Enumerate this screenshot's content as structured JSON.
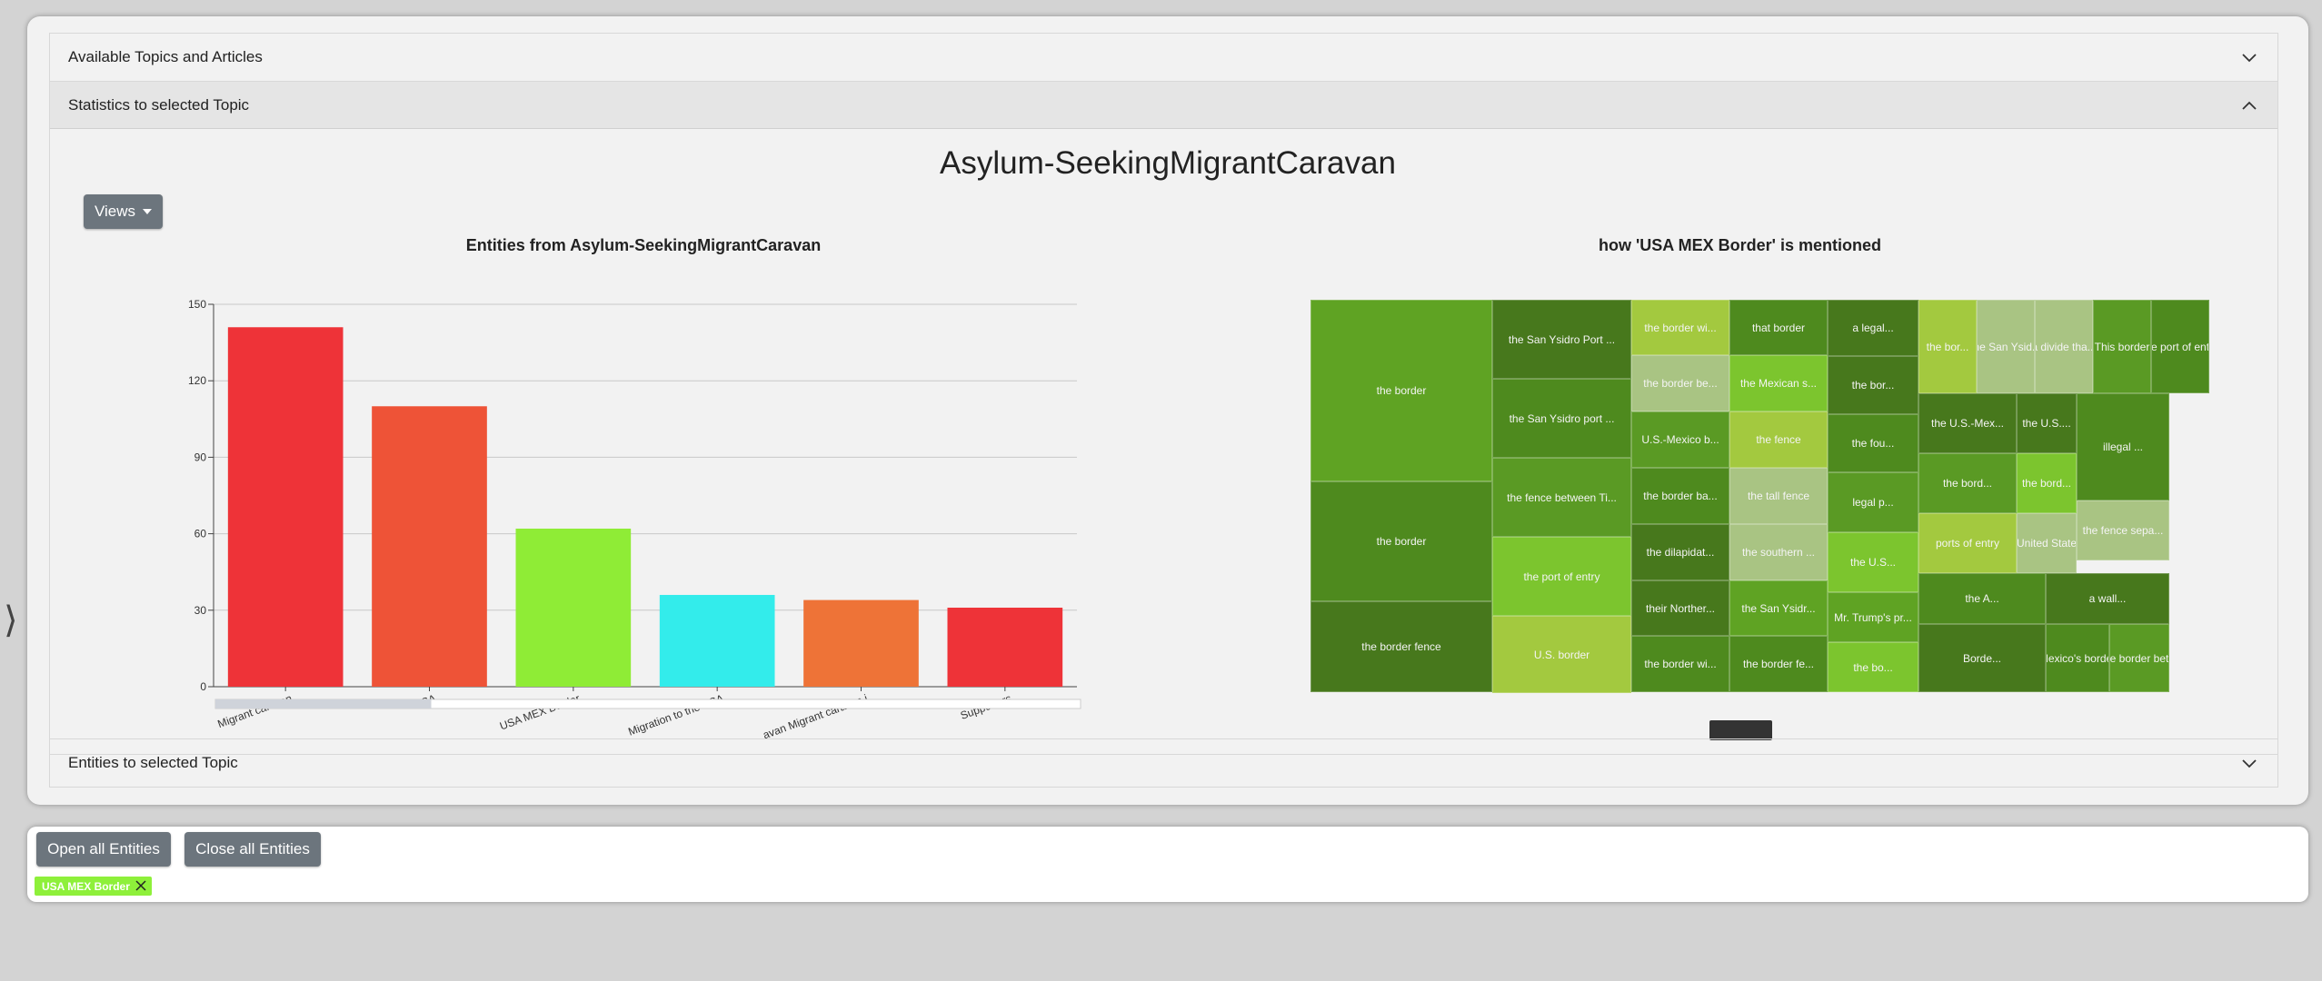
{
  "accordion": {
    "topics_header": "Available Topics and Articles",
    "stats_header": "Statistics to selected Topic",
    "entities_header": "Entities to selected Topic"
  },
  "topic": {
    "title": "Asylum-SeekingMigrantCaravan"
  },
  "views_button": {
    "label": "Views"
  },
  "chart_data": {
    "type": "bar",
    "title": "Entities from Asylum-SeekingMigrantCaravan",
    "categories": [
      "Migrant caravan",
      "USA",
      "USA MEX Border",
      "Migration to the USA",
      "Asylum-Seeking Migrant caravan i",
      "Supporters"
    ],
    "visible_tick_labels": [
      "Migrant caravan",
      "USA",
      "USA MEX Border",
      "Migration to the USA",
      "avan Migrant caravan i",
      "Supporters"
    ],
    "values": [
      141,
      110,
      62,
      36,
      34,
      31
    ],
    "colors": [
      "#ee3338",
      "#ee5337",
      "#8fec36",
      "#33eceb",
      "#ee7337",
      "#ee3338"
    ],
    "ylim": [
      0,
      150
    ],
    "yticks": [
      0,
      30,
      60,
      90,
      120,
      150
    ],
    "grid": true,
    "xlabel": "",
    "ylabel": ""
  },
  "treemap": {
    "title": "how 'USA MEX Border' is mentioned",
    "cells": [
      {
        "label": "the border",
        "color": "#5fa323"
      },
      {
        "label": "the border",
        "color": "#4e8a1e"
      },
      {
        "label": "the border fence",
        "color": "#47781c"
      },
      {
        "label": "the San Ysidro Port ...",
        "color": "#47781c"
      },
      {
        "label": "the San Ysidro port ...",
        "color": "#4e8a1e"
      },
      {
        "label": "the fence between Ti...",
        "color": "#5a9a24"
      },
      {
        "label": "the port of entry",
        "color": "#7cc52e"
      },
      {
        "label": "U.S. border",
        "color": "#a3c93f"
      },
      {
        "label": "the border wi...",
        "color": "#a3c93f"
      },
      {
        "label": "the border be...",
        "color": "#a9c483"
      },
      {
        "label": "U.S.-Mexico b...",
        "color": "#5a9a24"
      },
      {
        "label": "the border ba...",
        "color": "#4e8a1e"
      },
      {
        "label": "the dilapidat...",
        "color": "#47781c"
      },
      {
        "label": "their Norther...",
        "color": "#47781c"
      },
      {
        "label": "the border wi...",
        "color": "#4e8a1e"
      },
      {
        "label": "that border",
        "color": "#4e8a1e"
      },
      {
        "label": "the Mexican s...",
        "color": "#7cc52e"
      },
      {
        "label": "the fence",
        "color": "#a3c93f"
      },
      {
        "label": "the tall fence",
        "color": "#a9c483"
      },
      {
        "label": "the southern ...",
        "color": "#a9c483"
      },
      {
        "label": "the San Ysidr...",
        "color": "#5fa323"
      },
      {
        "label": "the border fe...",
        "color": "#4e8a1e"
      },
      {
        "label": "a legal...",
        "color": "#47781c"
      },
      {
        "label": "the bor...",
        "color": "#47781c"
      },
      {
        "label": "the fou...",
        "color": "#4e8a1e"
      },
      {
        "label": "legal p...",
        "color": "#5a9a24"
      },
      {
        "label": "the U.S...",
        "color": "#7cc52e"
      },
      {
        "label": "the bor...",
        "color": "#a3c93f"
      },
      {
        "label": "the San Ysid...",
        "color": "#a9c483"
      },
      {
        "label": "a divide tha...",
        "color": "#a9c483"
      },
      {
        "label": "This border",
        "color": "#5a9a24"
      },
      {
        "label": "the port of entry",
        "color": "#4e8a1e"
      },
      {
        "label": "the U.S.-Mex...",
        "color": "#47781c"
      },
      {
        "label": "the U.S....",
        "color": "#47781c"
      },
      {
        "label": "illegal ...",
        "color": "#4e8a1e"
      },
      {
        "label": "the bord...",
        "color": "#5a9a24"
      },
      {
        "label": "the bord...",
        "color": "#7cc52e"
      },
      {
        "label": "ports of entry",
        "color": "#a3c93f"
      },
      {
        "label": "a United State...",
        "color": "#a9c483"
      },
      {
        "label": "the fence sepa...",
        "color": "#a9c483"
      },
      {
        "label": "Mr. Trump's pr...",
        "color": "#5fa323"
      },
      {
        "label": "the A...",
        "color": "#4e8a1e"
      },
      {
        "label": "a wall...",
        "color": "#47781c"
      },
      {
        "label": "Borde...",
        "color": "#47781c"
      },
      {
        "label": "Mexico's border",
        "color": "#4e8a1e"
      },
      {
        "label": "the border bet...",
        "color": "#5a9a24"
      },
      {
        "label": "the bo...",
        "color": "#7cc52e"
      }
    ]
  },
  "bottom": {
    "open_all_label": "Open all Entities",
    "close_all_label": "Close all Entities",
    "tag_label": "USA MEX Border"
  },
  "side_toggle": "⟩"
}
